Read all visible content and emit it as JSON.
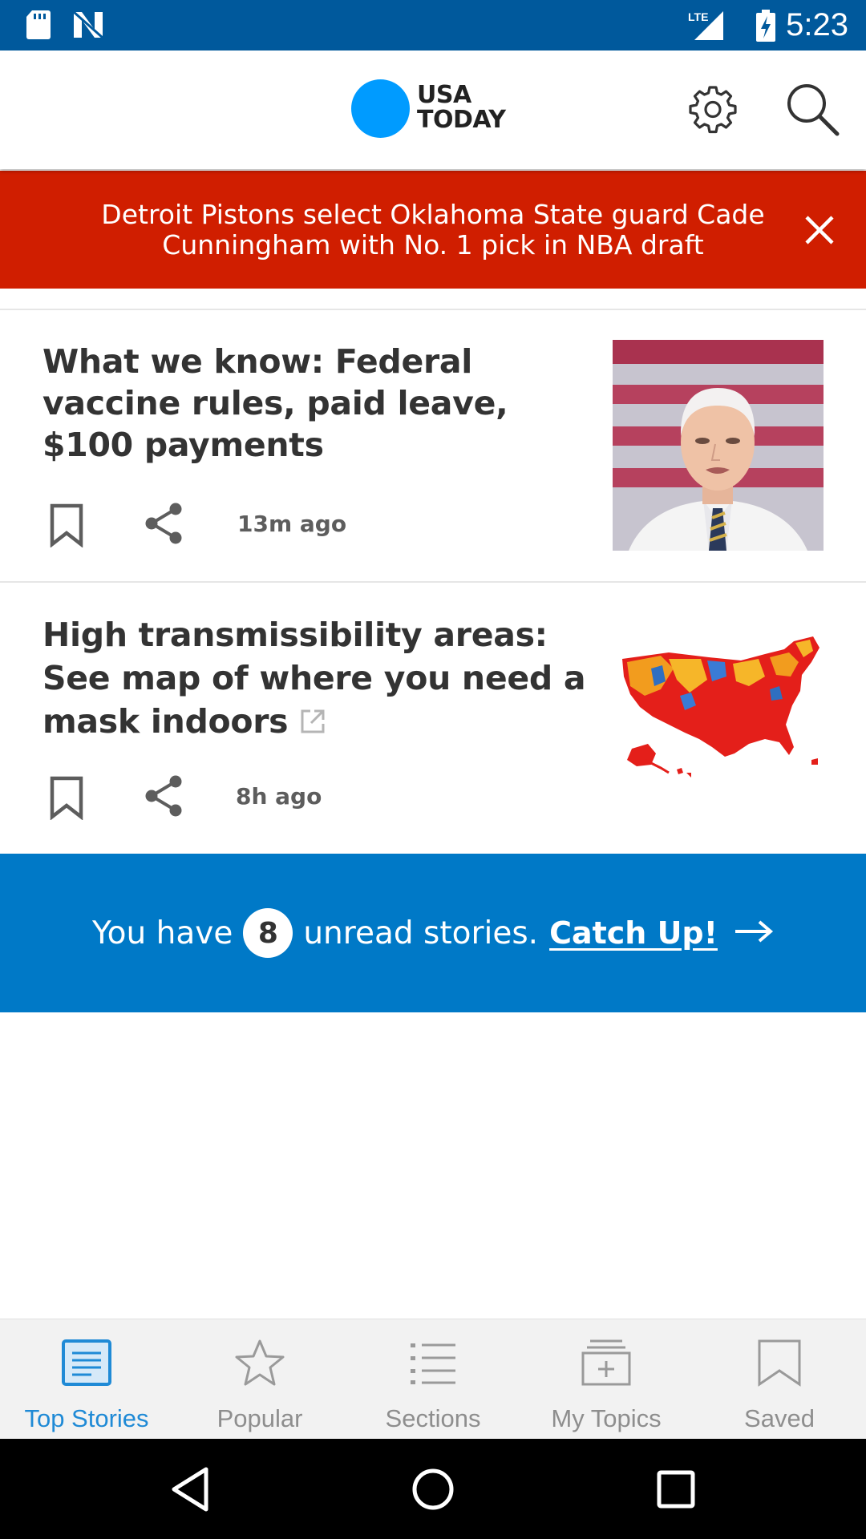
{
  "status_bar": {
    "time": "5:23",
    "network": "LTE",
    "icons": [
      "sd-card-icon",
      "n-notification-icon",
      "signal-icon",
      "battery-charging-icon"
    ]
  },
  "header": {
    "logo_line1": "USA",
    "logo_line2": "TODAY",
    "logo_color": "#009bff",
    "settings_icon": "gear-icon",
    "search_icon": "search-icon"
  },
  "breaking": {
    "text": "Detroit Pistons select Oklahoma State guard Cade Cunningham with No. 1 pick in NBA draft",
    "color": "#d01e00",
    "close_icon": "close-icon"
  },
  "stories": [
    {
      "title": "What we know: Federal vaccine rules, paid leave, $100 payments",
      "time": "13m ago",
      "external": false,
      "thumbnail": "photo-of-man-in-suit"
    },
    {
      "title": "High transmissibility areas: See map of where you need a mask indoors",
      "time": "8h ago",
      "external": true,
      "thumbnail": "us-county-map"
    }
  ],
  "catchup": {
    "prefix": "You have",
    "count": "8",
    "suffix": "unread stories.",
    "link": "Catch Up!",
    "color": "#0079c7"
  },
  "bottom_nav": {
    "items": [
      {
        "label": "Top Stories",
        "icon": "top-stories-icon",
        "active": true
      },
      {
        "label": "Popular",
        "icon": "star-icon",
        "active": false
      },
      {
        "label": "Sections",
        "icon": "list-icon",
        "active": false
      },
      {
        "label": "My Topics",
        "icon": "topics-folder-icon",
        "active": false
      },
      {
        "label": "Saved",
        "icon": "bookmark-icon",
        "active": false
      }
    ],
    "active_color": "#1f8ad6"
  }
}
